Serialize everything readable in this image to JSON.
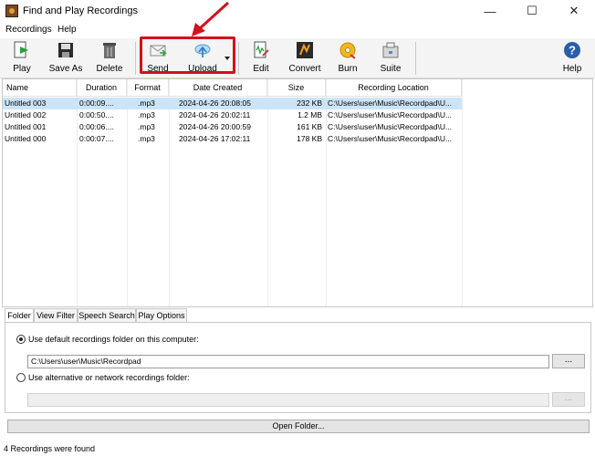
{
  "window": {
    "title": "Find and Play Recordings",
    "minimize_glyph": "—",
    "maximize_glyph": "☐",
    "close_glyph": "✕"
  },
  "menu": [
    "Recordings",
    "Help"
  ],
  "toolbar": {
    "play": "Play",
    "save_as": "Save As",
    "delete": "Delete",
    "send": "Send",
    "upload": "Upload",
    "edit": "Edit",
    "convert": "Convert",
    "burn": "Burn",
    "suite": "Suite",
    "help": "Help",
    "highlight_color": "#d0121b"
  },
  "table": {
    "headers": [
      "Name",
      "Duration",
      "Format",
      "Date Created",
      "Size",
      "Recording Location"
    ],
    "rows": [
      [
        "Untitled 003",
        "0:00:09....",
        ".mp3",
        "2024-04-26 20:08:05",
        "232 KB",
        "C:\\Users\\user\\Music\\Recordpad\\U..."
      ],
      [
        "Untitled 002",
        "0:00:50....",
        ".mp3",
        "2024-04-26 20:02:11",
        "1.2 MB",
        "C:\\Users\\user\\Music\\Recordpad\\U..."
      ],
      [
        "Untitled 001",
        "0:00:06....",
        ".mp3",
        "2024-04-26 20:00:59",
        "161 KB",
        "C:\\Users\\user\\Music\\Recordpad\\U..."
      ],
      [
        "Untitled 000",
        "0:00:07....",
        ".mp3",
        "2024-04-26 17:02:11",
        "178 KB",
        "C:\\Users\\user\\Music\\Recordpad\\U..."
      ]
    ],
    "selected_row_color": "#cce4f7"
  },
  "tabs": [
    "Folder",
    "View Filter",
    "Speech Search",
    "Play Options"
  ],
  "folder": {
    "default_label": "Use default recordings folder on this computer:",
    "default_path": "C:\\Users\\user\\Music\\Recordpad",
    "alt_label": "Use alternative or network recordings folder:",
    "alt_path": "",
    "browse": "...",
    "open_folder": "Open Folder..."
  },
  "status": "4 Recordings were found"
}
